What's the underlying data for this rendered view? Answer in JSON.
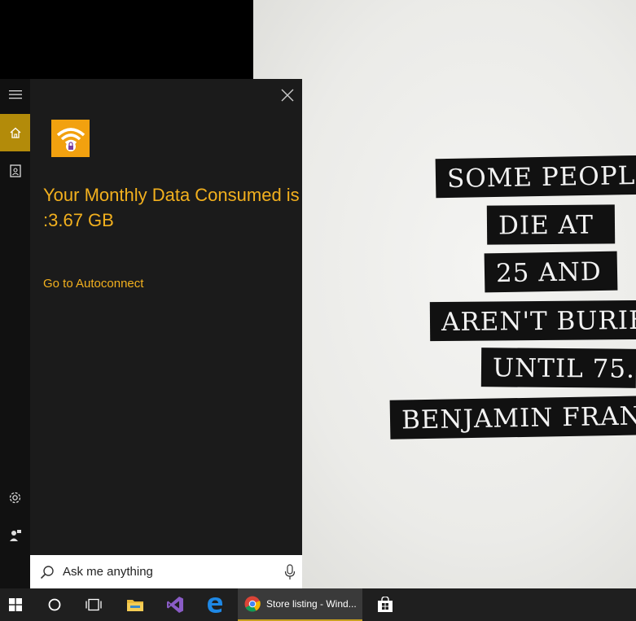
{
  "wallpaper": {
    "quote_lines": [
      "SOME PEOPLE",
      "DIE AT",
      "25 AND",
      "AREN'T BURIE",
      "UNTIL 75.",
      "BENJAMIN FRAN"
    ]
  },
  "cortana": {
    "nav": [
      {
        "id": "menu",
        "icon": "hamburger-icon"
      },
      {
        "id": "home",
        "icon": "home-icon",
        "active": true
      },
      {
        "id": "notebook",
        "icon": "notebook-icon"
      },
      {
        "id": "settings",
        "icon": "gear-icon"
      },
      {
        "id": "feedback",
        "icon": "feedback-icon"
      }
    ],
    "app_icon": "wifi-lock-icon",
    "message": "Your Monthly Data Consumed is :3.67 GB",
    "link_text": "Go to Autoconnect",
    "search_placeholder": "Ask me anything",
    "accent_color": "#f2b01e",
    "active_color": "#b38b0a"
  },
  "taskbar": {
    "items": [
      {
        "icon": "windows-start-icon"
      },
      {
        "icon": "cortana-circle-icon"
      },
      {
        "icon": "task-view-icon"
      },
      {
        "icon": "file-explorer-icon"
      },
      {
        "icon": "visual-studio-icon"
      },
      {
        "icon": "edge-icon"
      },
      {
        "icon": "chrome-icon",
        "label": "Store listing - Wind...",
        "active": true
      },
      {
        "icon": "store-icon"
      }
    ]
  }
}
